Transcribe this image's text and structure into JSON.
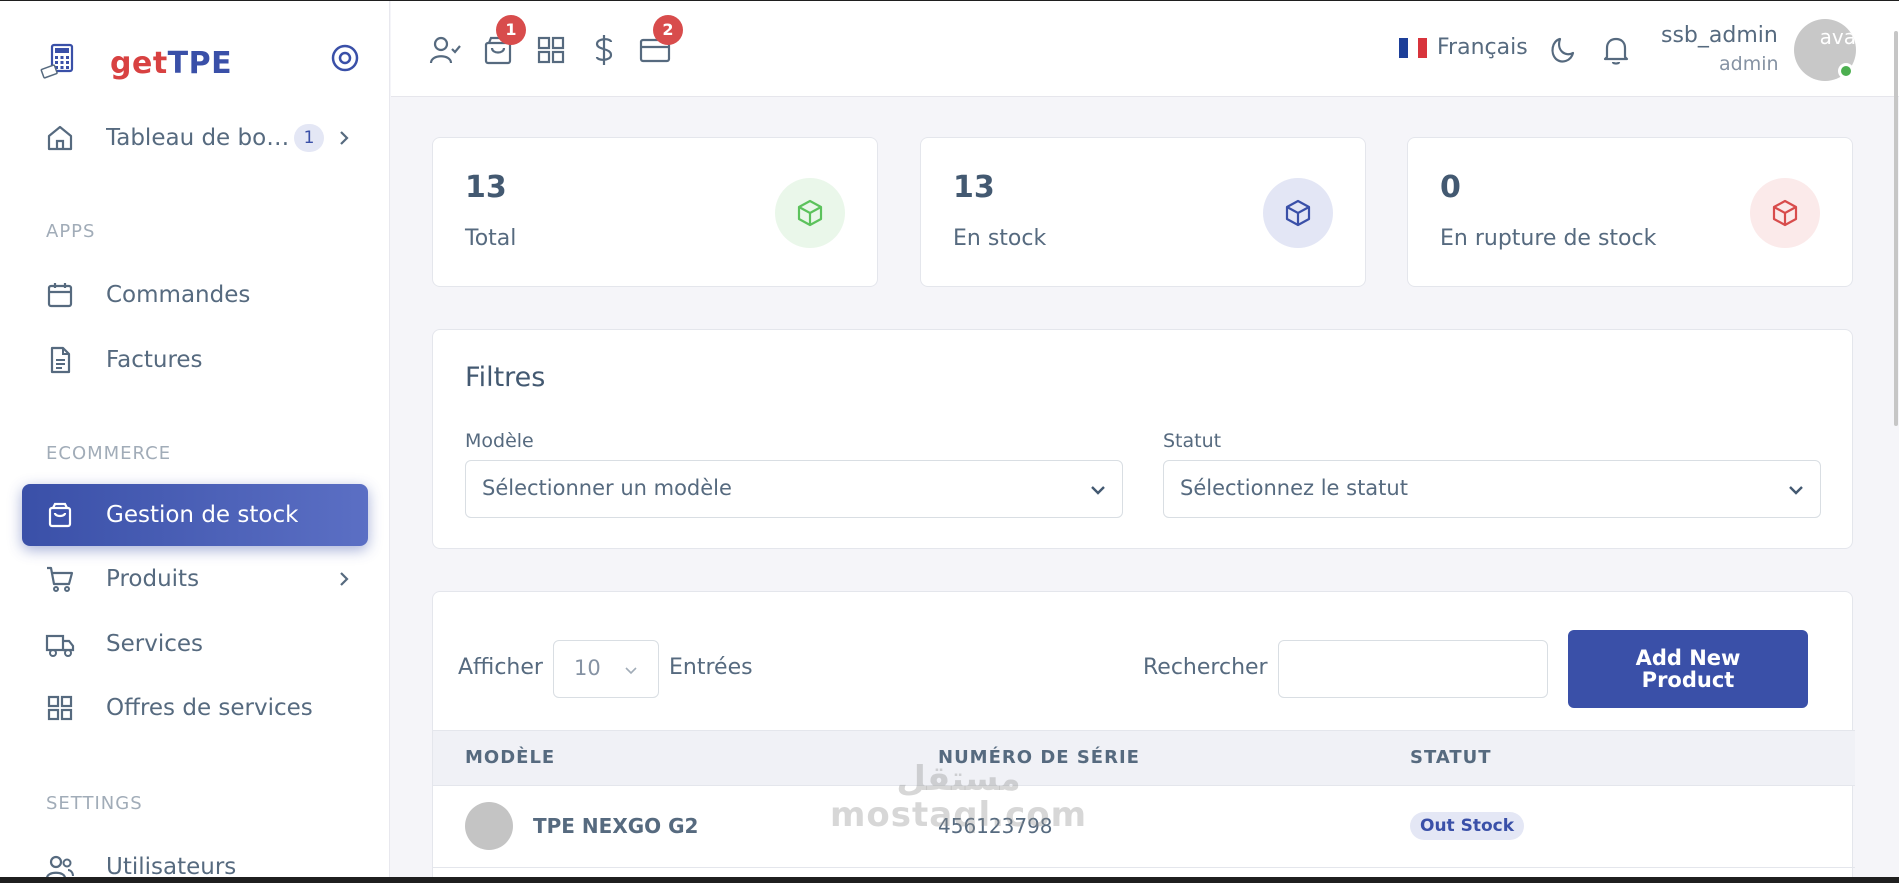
{
  "brand": {
    "part1": "get",
    "part2": "TPE"
  },
  "sidebar": {
    "dashboard": {
      "label": "Tableau de board",
      "badge": "1"
    },
    "sections": {
      "apps": "APPS",
      "ecommerce": "ECOMMERCE",
      "settings": "SETTINGS"
    },
    "items": [
      {
        "label": "Commandes",
        "icon": "calendar-icon"
      },
      {
        "label": "Factures",
        "icon": "file-text-icon"
      },
      {
        "label": "Gestion de stock",
        "icon": "shopping-bag-icon",
        "active": true
      },
      {
        "label": "Produits",
        "icon": "cart-icon"
      },
      {
        "label": "Services",
        "icon": "truck-icon"
      },
      {
        "label": "Offres de services",
        "icon": "grid-icon"
      },
      {
        "label": "Utilisateurs",
        "icon": "users-icon"
      }
    ]
  },
  "topbar": {
    "cart_badge": "1",
    "card_badge": "2",
    "language": "Français",
    "user_name": "ssb_admin",
    "user_role": "admin",
    "avatar_alt": "ava"
  },
  "stats": [
    {
      "value": "13",
      "label": "Total",
      "color": "#71dd37"
    },
    {
      "value": "13",
      "label": "En stock",
      "color": "#3a50a8"
    },
    {
      "value": "0",
      "label": "En rupture de stock",
      "color": "#d84c4c"
    }
  ],
  "filters": {
    "title": "Filtres",
    "model_label": "Modèle",
    "model_placeholder": "Sélectionner un modèle",
    "status_label": "Statut",
    "status_placeholder": "Sélectionnez le statut"
  },
  "table": {
    "show_label": "Afficher",
    "page_length": "10",
    "entries_label": "Entrées",
    "search_label": "Rechercher",
    "add_button": "Add New Product",
    "columns": [
      "MODÈLE",
      "NUMÉRO DE SÉRIE",
      "STATUT"
    ],
    "rows": [
      {
        "model": "TPE NEXGO G2",
        "serial": "456123798",
        "status": "Out Stock"
      }
    ]
  },
  "watermark": {
    "line1": "مستقل",
    "line2": "mostaql.com"
  }
}
